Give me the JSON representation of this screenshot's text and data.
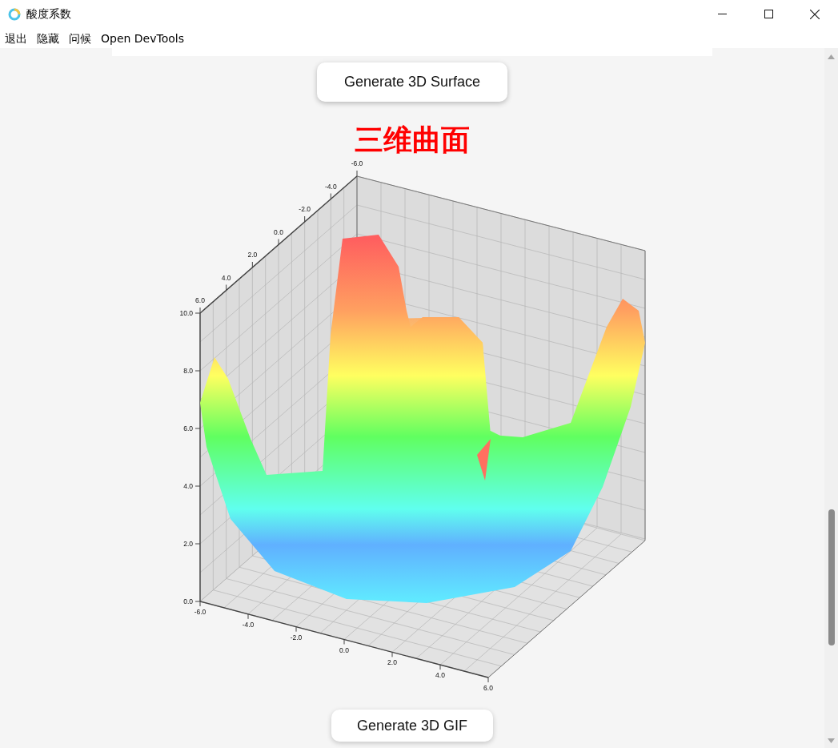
{
  "window": {
    "title": "酸度系数"
  },
  "menu": [
    {
      "label": "退出"
    },
    {
      "label": "隐藏"
    },
    {
      "label": "问候"
    },
    {
      "label": "Open DevTools"
    }
  ],
  "surface_button": {
    "label": "Generate 3D Surface"
  },
  "surface_plot": {
    "title": "三维曲面",
    "depth_ticks": [
      "-6.0",
      "-4.0",
      "-2.0",
      "0.0",
      "2.0",
      "4.0",
      "6.0"
    ],
    "z_ticks": [
      "10.0",
      "8.0",
      "6.0",
      "4.0",
      "2.0",
      "0.0"
    ],
    "x_ticks": [
      "-6.0",
      "-4.0",
      "-2.0",
      "0.0",
      "2.0",
      "4.0",
      "6.0"
    ]
  },
  "gif_button": {
    "label": "Generate 3D GIF"
  }
}
